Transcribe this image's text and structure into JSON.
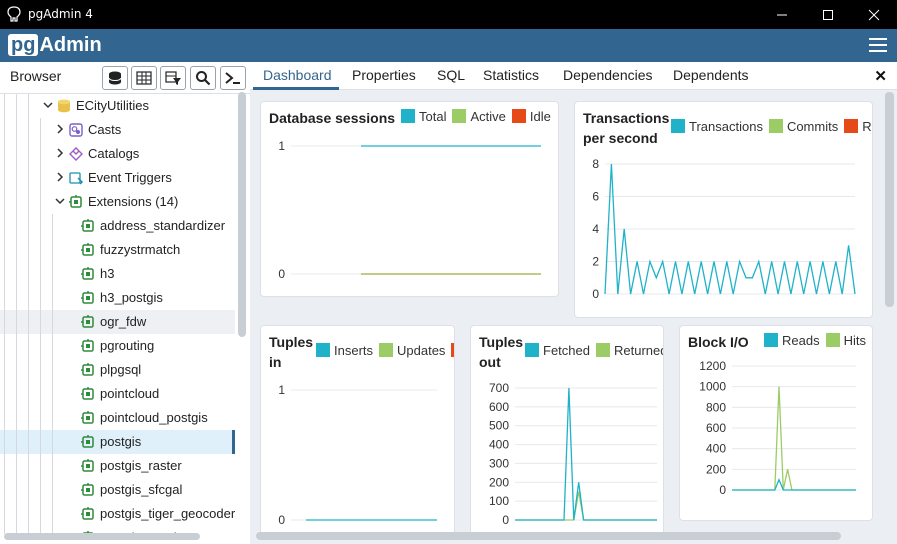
{
  "window": {
    "title": "pgAdmin 4"
  },
  "header": {
    "logo_pg": "pg",
    "logo_admin": "Admin"
  },
  "browser": {
    "label": "Browser",
    "tree": [
      {
        "label": "ECityUtilities",
        "icon": "database-icon",
        "chevron": "down",
        "level": 3
      },
      {
        "label": "Casts",
        "icon": "casts-icon",
        "chevron": "right",
        "level": 4
      },
      {
        "label": "Catalogs",
        "icon": "catalogs-icon",
        "chevron": "right",
        "level": 4
      },
      {
        "label": "Event Triggers",
        "icon": "event-trigger-icon",
        "chevron": "right",
        "level": 4
      },
      {
        "label": "Extensions (14)",
        "icon": "extension-icon",
        "chevron": "down",
        "level": 4
      },
      {
        "label": "address_standardizer",
        "icon": "extension-icon",
        "level": 5
      },
      {
        "label": "fuzzystrmatch",
        "icon": "extension-icon",
        "level": 5
      },
      {
        "label": "h3",
        "icon": "extension-icon",
        "level": 5
      },
      {
        "label": "h3_postgis",
        "icon": "extension-icon",
        "level": 5
      },
      {
        "label": "ogr_fdw",
        "icon": "extension-icon",
        "level": 5,
        "state": "hover"
      },
      {
        "label": "pgrouting",
        "icon": "extension-icon",
        "level": 5
      },
      {
        "label": "plpgsql",
        "icon": "extension-icon",
        "level": 5
      },
      {
        "label": "pointcloud",
        "icon": "extension-icon",
        "level": 5
      },
      {
        "label": "pointcloud_postgis",
        "icon": "extension-icon",
        "level": 5
      },
      {
        "label": "postgis",
        "icon": "extension-icon",
        "level": 5,
        "state": "selected"
      },
      {
        "label": "postgis_raster",
        "icon": "extension-icon",
        "level": 5
      },
      {
        "label": "postgis_sfcgal",
        "icon": "extension-icon",
        "level": 5
      },
      {
        "label": "postgis_tiger_geocoder",
        "icon": "extension-icon",
        "level": 5
      },
      {
        "label": "postgis_topology",
        "icon": "extension-icon",
        "level": 5
      }
    ]
  },
  "tabs": [
    "Dashboard",
    "Properties",
    "SQL",
    "Statistics",
    "Dependencies",
    "Dependents"
  ],
  "colors": {
    "teal": "#1fb2c9",
    "green": "#9ccc65",
    "orange": "#e64a19",
    "brand": "#326690"
  },
  "chart_data": [
    {
      "type": "line",
      "title": "Database sessions",
      "series": [
        {
          "name": "Total",
          "values": [
            1,
            1,
            1,
            1,
            1,
            1,
            1,
            1,
            1,
            1,
            1,
            1,
            1,
            1,
            1,
            1,
            1,
            1,
            1,
            1
          ]
        },
        {
          "name": "Active",
          "values": [
            0,
            0,
            0,
            0,
            0,
            0,
            0,
            0,
            0,
            0,
            0,
            0,
            0,
            0,
            0,
            0,
            0,
            0,
            0,
            0
          ]
        },
        {
          "name": "Idle",
          "values": [
            0,
            0,
            0,
            0,
            0,
            0,
            0,
            0,
            0,
            0,
            0,
            0,
            0,
            0,
            0,
            0,
            0,
            0,
            0,
            0
          ]
        }
      ],
      "yticks": [
        "1",
        "0"
      ],
      "ylim": [
        0,
        1
      ]
    },
    {
      "type": "line",
      "title": "Transactions per second",
      "series": [
        {
          "name": "Transactions",
          "values": [
            0,
            8,
            0,
            4,
            0,
            2,
            0,
            2,
            1,
            2,
            0,
            2,
            0,
            2,
            0,
            2,
            0,
            2,
            0,
            2,
            0,
            2,
            1,
            1,
            2,
            0,
            2,
            0,
            2,
            0,
            2,
            0,
            2,
            0,
            2,
            0,
            2,
            0,
            3,
            0
          ]
        },
        {
          "name": "Commits",
          "values": []
        },
        {
          "name": "Rollbacks",
          "values": []
        }
      ],
      "legend_cut": "Rol",
      "yticks": [
        "8",
        "6",
        "4",
        "2",
        "0"
      ],
      "ylim": [
        0,
        8
      ]
    },
    {
      "type": "line",
      "title": "Tuples in",
      "series": [
        {
          "name": "Inserts",
          "values": [
            0,
            0,
            0,
            0,
            0,
            0,
            0,
            0,
            0,
            0
          ]
        },
        {
          "name": "Updates",
          "values": []
        },
        {
          "name": "Deletes",
          "values": []
        }
      ],
      "legend_cut": "D",
      "yticks": [
        "1",
        "0"
      ],
      "ylim": [
        0,
        1
      ]
    },
    {
      "type": "line",
      "title": "Tuples out",
      "series": [
        {
          "name": "Fetched",
          "values": [
            0,
            0,
            0,
            0,
            0,
            0,
            0,
            0,
            0,
            0,
            0,
            700,
            0,
            200,
            0,
            0,
            0,
            0,
            0,
            0,
            0,
            0,
            0,
            0,
            0,
            0,
            0,
            0,
            0,
            0
          ]
        },
        {
          "name": "Returned",
          "values": [
            0,
            0,
            0,
            0,
            0,
            0,
            0,
            0,
            0,
            0,
            0,
            0,
            0,
            150,
            0,
            0,
            0,
            0,
            0,
            0,
            0,
            0,
            0,
            0,
            0,
            0,
            0,
            0,
            0,
            0
          ]
        }
      ],
      "yticks": [
        "700",
        "600",
        "500",
        "400",
        "300",
        "200",
        "100",
        "0"
      ],
      "ylim": [
        0,
        700
      ]
    },
    {
      "type": "line",
      "title": "Block I/O",
      "series": [
        {
          "name": "Reads",
          "values": [
            0,
            0,
            0,
            0,
            0,
            0,
            0,
            0,
            0,
            0,
            0,
            100,
            0,
            0,
            0,
            0,
            0,
            0,
            0,
            0,
            0,
            0,
            0,
            0,
            0,
            0,
            0,
            0,
            0,
            0
          ]
        },
        {
          "name": "Hits",
          "values": [
            0,
            0,
            0,
            0,
            0,
            0,
            0,
            0,
            0,
            0,
            0,
            1000,
            0,
            200,
            0,
            0,
            0,
            0,
            0,
            0,
            0,
            0,
            0,
            0,
            0,
            0,
            0,
            0,
            0,
            0
          ]
        }
      ],
      "yticks": [
        "1200",
        "1000",
        "800",
        "600",
        "400",
        "200",
        "0"
      ],
      "ylim": [
        0,
        1200
      ]
    }
  ]
}
